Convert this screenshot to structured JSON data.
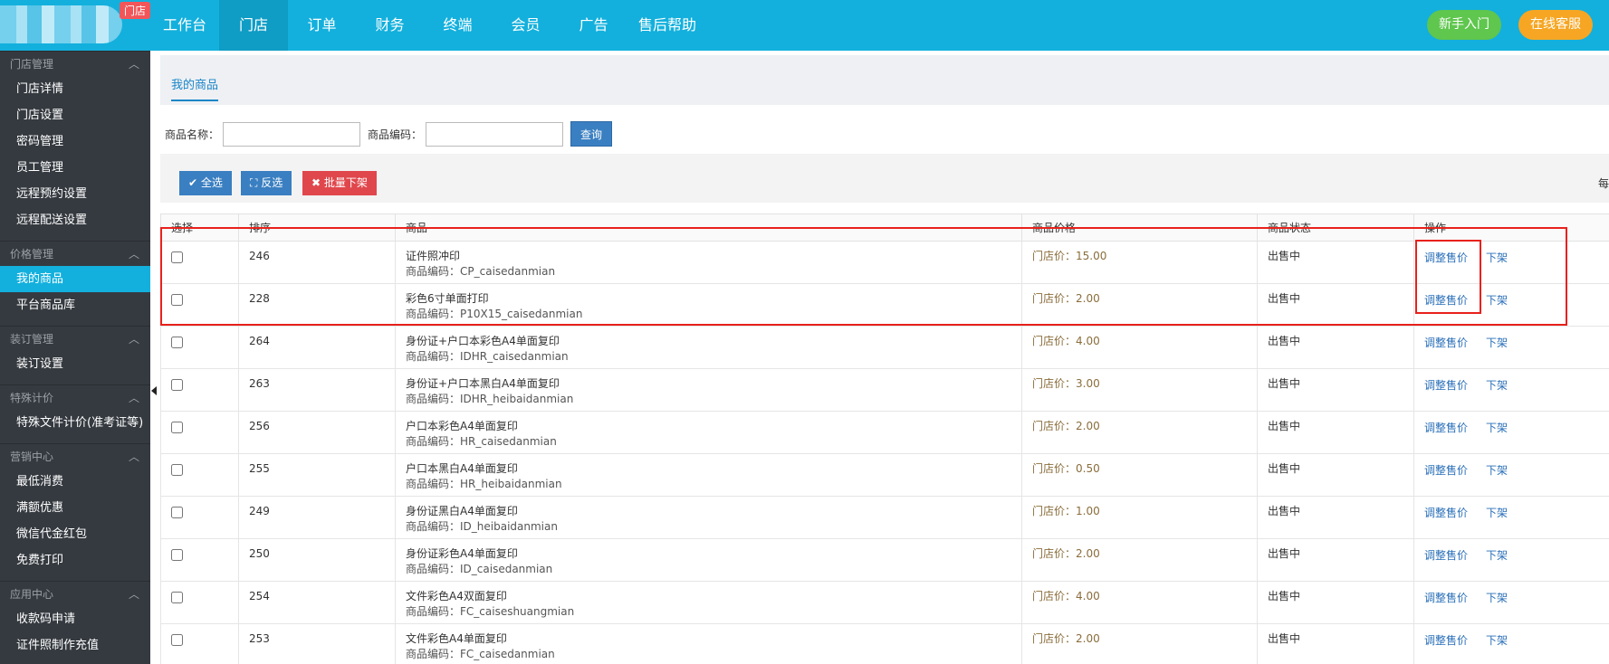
{
  "header": {
    "logo_tag": "门店",
    "nav": [
      "工作台",
      "门店",
      "订单",
      "财务",
      "终端",
      "会员",
      "广告",
      "售后帮助"
    ],
    "active_nav": "门店",
    "newbie_button": "新手入门",
    "service_button": "在线客服"
  },
  "sidebar": {
    "sections": [
      {
        "title": "门店管理",
        "items": [
          "门店详情",
          "门店设置",
          "密码管理",
          "员工管理",
          "远程预约设置",
          "远程配送设置"
        ]
      },
      {
        "title": "价格管理",
        "items": [
          "我的商品",
          "平台商品库"
        ]
      },
      {
        "title": "装订管理",
        "items": [
          "装订设置"
        ]
      },
      {
        "title": "特殊计价",
        "items": [
          "特殊文件计价(准考证等)"
        ]
      },
      {
        "title": "营销中心",
        "items": [
          "最低消费",
          "满额优惠",
          "微信代金红包",
          "免费打印"
        ]
      },
      {
        "title": "应用中心",
        "items": [
          "收款码申请",
          "证件照制作充值"
        ]
      }
    ],
    "active_item": "我的商品"
  },
  "main": {
    "tab": "我的商品",
    "search": {
      "name_label": "商品名称：",
      "name_value": "",
      "code_label": "商品编码：",
      "code_value": "",
      "query_button": "查询"
    },
    "actions": {
      "select_all": "全选",
      "invert": "反选",
      "batch_off": "批量下架",
      "edge_text": "每"
    },
    "table": {
      "columns": [
        "选择",
        "排序",
        "商品",
        "商品价格",
        "商品状态",
        "操作"
      ],
      "rows": [
        {
          "order": "246",
          "name": "证件照冲印",
          "code": "商品编码：CP_caisedanmian",
          "price": "门店价：15.00",
          "status": "出售中",
          "adjust": "调整售价",
          "off": "下架"
        },
        {
          "order": "228",
          "name": "彩色6寸单面打印",
          "code": "商品编码：P10X15_caisedanmian",
          "price": "门店价：2.00",
          "status": "出售中",
          "adjust": "调整售价",
          "off": "下架"
        },
        {
          "order": "264",
          "name": "身份证+户口本彩色A4单面复印",
          "code": "商品编码：IDHR_caisedanmian",
          "price": "门店价：4.00",
          "status": "出售中",
          "adjust": "调整售价",
          "off": "下架"
        },
        {
          "order": "263",
          "name": "身份证+户口本黑白A4单面复印",
          "code": "商品编码：IDHR_heibaidanmian",
          "price": "门店价：3.00",
          "status": "出售中",
          "adjust": "调整售价",
          "off": "下架"
        },
        {
          "order": "256",
          "name": "户口本彩色A4单面复印",
          "code": "商品编码：HR_caisedanmian",
          "price": "门店价：2.00",
          "status": "出售中",
          "adjust": "调整售价",
          "off": "下架"
        },
        {
          "order": "255",
          "name": "户口本黑白A4单面复印",
          "code": "商品编码：HR_heibaidanmian",
          "price": "门店价：0.50",
          "status": "出售中",
          "adjust": "调整售价",
          "off": "下架"
        },
        {
          "order": "249",
          "name": "身份证黑白A4单面复印",
          "code": "商品编码：ID_heibaidanmian",
          "price": "门店价：1.00",
          "status": "出售中",
          "adjust": "调整售价",
          "off": "下架"
        },
        {
          "order": "250",
          "name": "身份证彩色A4单面复印",
          "code": "商品编码：ID_caisedanmian",
          "price": "门店价：2.00",
          "status": "出售中",
          "adjust": "调整售价",
          "off": "下架"
        },
        {
          "order": "254",
          "name": "文件彩色A4双面复印",
          "code": "商品编码：FC_caiseshuangmian",
          "price": "门店价：4.00",
          "status": "出售中",
          "adjust": "调整售价",
          "off": "下架"
        },
        {
          "order": "253",
          "name": "文件彩色A4单面复印",
          "code": "商品编码：FC_caisedanmian",
          "price": "门店价：2.00",
          "status": "出售中",
          "adjust": "调整售价",
          "off": "下架"
        }
      ]
    }
  },
  "colors": {
    "topbar": "#13b0dd",
    "sidebar": "#353a40",
    "highlight": "#e8211c"
  }
}
